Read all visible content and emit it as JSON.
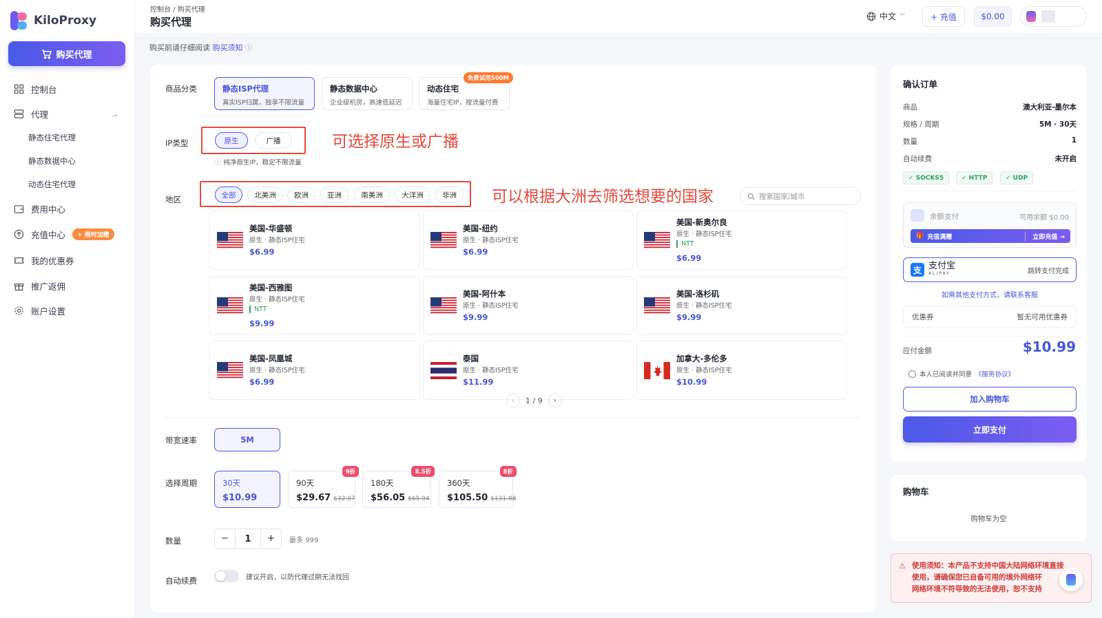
{
  "brand": {
    "name": "KiloProxy"
  },
  "sidebar": {
    "buy_label": "购买代理",
    "items": [
      {
        "label": "控制台"
      },
      {
        "label": "代理"
      },
      {
        "label": "静态住宅代理"
      },
      {
        "label": "静态数据中心"
      },
      {
        "label": "动态住宅代理"
      },
      {
        "label": "费用中心"
      },
      {
        "label": "充值中心",
        "badge": "+ 限时加赠"
      },
      {
        "label": "我的优惠券"
      },
      {
        "label": "推广返佣"
      },
      {
        "label": "账户设置"
      }
    ]
  },
  "header": {
    "breadcrumb": "控制台 / 购买代理",
    "title": "购买代理",
    "lang": "中文",
    "recharge": "+ 充值",
    "balance": "$0.00"
  },
  "notice": {
    "text": "购买前请仔细阅读",
    "link": "购买须知"
  },
  "form": {
    "category_label": "商品分类",
    "categories": [
      {
        "title": "静态ISP代理",
        "desc": "真实ISP归属，独享不限流量"
      },
      {
        "title": "静态数据中心",
        "desc": "企业级机房，高速低延迟"
      },
      {
        "title": "动态住宅",
        "desc": "海量住宅IP，按流量付费",
        "badge": "免费试用500M"
      }
    ],
    "ip_type_label": "IP类型",
    "ip_types": [
      "原生",
      "广播"
    ],
    "ip_hint": "纯净原生IP，稳定不限流量",
    "annotation_ip": "可选择原生或广播",
    "region_label": "地区",
    "regions": [
      "全部",
      "北美洲",
      "欧洲",
      "亚洲",
      "南美洲",
      "大洋洲",
      "非洲"
    ],
    "annotation_region": "可以根据大洲去筛选想要的国家",
    "search_placeholder": "搜索国家/城市",
    "locations": [
      {
        "name": "美国-华盛顿",
        "type": "原生 · 静态ISP住宅",
        "price": "$6.99",
        "flag": "us",
        "ntt": ""
      },
      {
        "name": "美国-纽约",
        "type": "原生 · 静态ISP住宅",
        "price": "$6.99",
        "flag": "us",
        "ntt": ""
      },
      {
        "name": "美国-新奥尔良",
        "type": "原生 · 静态ISP住宅",
        "price": "$6.99",
        "flag": "us",
        "ntt": "NTT"
      },
      {
        "name": "美国-西雅图",
        "type": "原生 · 静态ISP住宅",
        "price": "$9.99",
        "flag": "us",
        "ntt": "NTT"
      },
      {
        "name": "美国-阿什本",
        "type": "原生 · 静态ISP住宅",
        "price": "$9.99",
        "flag": "us",
        "ntt": ""
      },
      {
        "name": "美国-洛杉矶",
        "type": "原生 · 静态ISP住宅",
        "price": "$9.99",
        "flag": "us",
        "ntt": ""
      },
      {
        "name": "美国-凤凰城",
        "type": "原生 · 静态ISP住宅",
        "price": "$6.99",
        "flag": "us",
        "ntt": ""
      },
      {
        "name": "泰国",
        "type": "原生 · 静态ISP住宅",
        "price": "$11.99",
        "flag": "th",
        "ntt": ""
      },
      {
        "name": "加拿大-多伦多",
        "type": "原生 · 静态ISP住宅",
        "price": "$10.99",
        "flag": "ca",
        "ntt": ""
      }
    ],
    "pager": "1 / 9",
    "bandwidth_label": "带宽速率",
    "bandwidth": "5M",
    "period_label": "选择周期",
    "periods": [
      {
        "days": "30天",
        "price": "$10.99",
        "orig": "",
        "discount": ""
      },
      {
        "days": "90天",
        "price": "$29.67",
        "orig": "$32.97",
        "discount": "9折"
      },
      {
        "days": "180天",
        "price": "$56.05",
        "orig": "$65.94",
        "discount": "8.5折"
      },
      {
        "days": "360天",
        "price": "$105.50",
        "orig": "$131.88",
        "discount": "8折"
      }
    ],
    "qty_label": "数量",
    "qty": "1",
    "qty_max": "最多 999",
    "renew_label": "自动续费",
    "renew_hint": "建议开启，以防代理过期无法找回"
  },
  "order": {
    "title": "确认订单",
    "rows": [
      {
        "k": "商品",
        "v": "澳大利亚-墨尔本"
      },
      {
        "k": "规格 / 周期",
        "v": "5M · 30天"
      },
      {
        "k": "数量",
        "v": "1"
      },
      {
        "k": "自动续费",
        "v": "未开启"
      }
    ],
    "protocols": [
      "✓ SOCKS5",
      "✓ HTTP",
      "✓ UDP"
    ],
    "balance_pay": "余额支付",
    "balance_avail": "可用余额 $0.00",
    "recharge_bar": "充值满赠",
    "recharge_now": "立即充值 →",
    "alipay": "支付宝",
    "alipay_sub": "ALIPAY",
    "alipay_hint": "跳转支付完成",
    "other_pay": "如需其他支付方式，请联系客服",
    "coupon_label": "优惠券",
    "coupon_value": "暂无可用优惠券",
    "total_label": "应付金额",
    "total": "$10.99",
    "agree": "本人已阅读并同意",
    "agree_link": "《服务协议》",
    "add_cart": "加入购物车",
    "pay_now": "立即支付"
  },
  "cart": {
    "title": "购物车",
    "empty": "购物车为空"
  },
  "warning": {
    "line1": "使用须知：本产品不支持中国大陆网络环境直接",
    "line2": "使用，请确保您已自备可用的境外网络环",
    "line3": "网络环境不符导致的无法使用，恕不支持"
  },
  "colors": {
    "accent": "#4b5ae8",
    "annotation": "#e5483c",
    "price": "#4756d9"
  }
}
